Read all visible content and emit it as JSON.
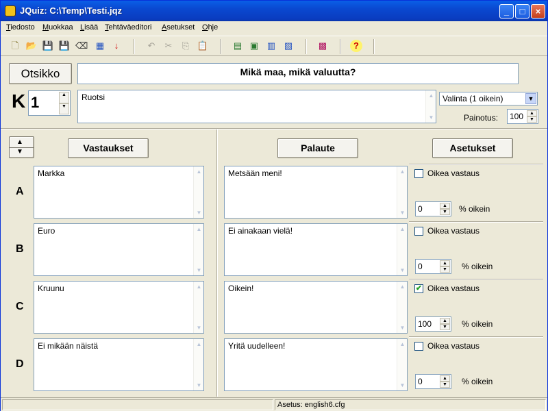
{
  "window": {
    "title": "JQuiz: C:\\Temp\\Testi.jqz"
  },
  "menu": {
    "items": [
      {
        "first": "T",
        "rest": "iedosto"
      },
      {
        "first": "M",
        "rest": "uokkaa"
      },
      {
        "first": "L",
        "rest": "isää"
      },
      {
        "first": "T",
        "rest": "ehtäväeditori"
      },
      {
        "first": "A",
        "rest": "setukset"
      },
      {
        "first": "O",
        "rest": "hje"
      }
    ]
  },
  "toolbar": {
    "icons": [
      "new-file-icon",
      "open-folder-icon",
      "save-icon",
      "save-as-icon",
      "eraser-icon",
      "web-export-icon",
      "arrow-down-icon",
      "undo-icon",
      "cut-icon",
      "copy-icon",
      "paste-icon",
      "export-html-icon",
      "export-page-icon",
      "export-drag-icon",
      "export-frames-icon",
      "config-icon",
      "help-icon"
    ],
    "glyphs": [
      "🗋",
      "📂",
      "💾",
      "💾",
      "⌫",
      "▦",
      "↓",
      "↶",
      "✂",
      "⎘",
      "📋",
      "▤",
      "▣",
      "▥",
      "▧",
      "▩",
      "?"
    ]
  },
  "header": {
    "title_button": "Otsikko",
    "title_value": "Mikä maa, mikä valuutta?",
    "question_letter": "K",
    "question_number": "1",
    "question_text": "Ruotsi",
    "question_type": "Valinta (1 oikein)",
    "weight_label": "Painotus:",
    "weight_value": "100"
  },
  "columns": {
    "answers_button": "Vastaukset",
    "feedback_button": "Palaute",
    "settings_button": "Asetukset"
  },
  "answers": [
    {
      "letter": "A",
      "text": "Markka",
      "feedback": "Metsään meni!",
      "correct_label": "Oikea vastaus",
      "correct": false,
      "percent": "0",
      "percent_label": "% oikein"
    },
    {
      "letter": "B",
      "text": "Euro",
      "feedback": "Ei ainakaan vielä!",
      "correct_label": "Oikea vastaus",
      "correct": false,
      "percent": "0",
      "percent_label": "% oikein"
    },
    {
      "letter": "C",
      "text": "Kruunu",
      "feedback": "Oikein!",
      "correct_label": "Oikea vastaus",
      "correct": true,
      "percent": "100",
      "percent_label": "% oikein"
    },
    {
      "letter": "D",
      "text": "Ei mikään näistä",
      "feedback": "Yritä uudelleen!",
      "correct_label": "Oikea vastaus",
      "correct": false,
      "percent": "0",
      "percent_label": "% oikein"
    }
  ],
  "status": {
    "config": "Asetus: english6.cfg"
  }
}
